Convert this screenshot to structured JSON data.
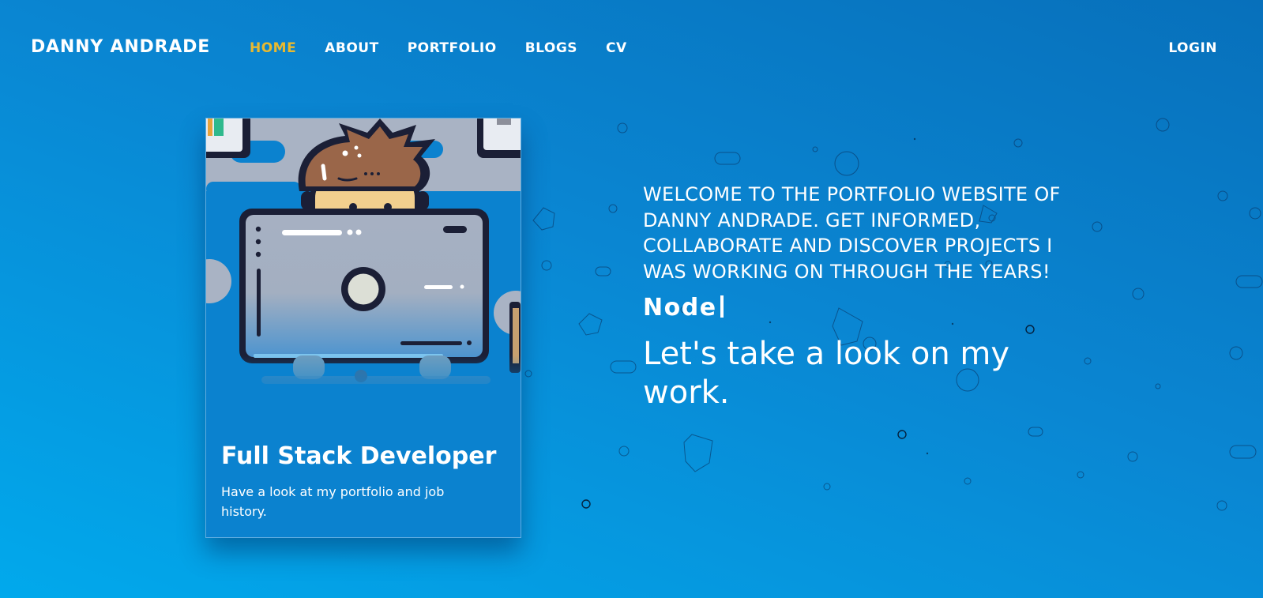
{
  "nav": {
    "brand": "DANNY ANDRADE",
    "links": [
      {
        "label": "HOME",
        "active": true
      },
      {
        "label": "ABOUT",
        "active": false
      },
      {
        "label": "PORTFOLIO",
        "active": false
      },
      {
        "label": "BLOGS",
        "active": false
      },
      {
        "label": "CV",
        "active": false
      }
    ],
    "login": "LOGIN"
  },
  "card": {
    "title": "Full Stack Developer",
    "text": "Have a look at my portfolio and job history."
  },
  "hero": {
    "welcome": "WELCOME TO THE PORTFOLIO WEBSITE OF DANNY ANDRADE. GET INFORMED, COLLABORATE AND DISCOVER PROJECTS I WAS WORKING ON THROUGH THE YEARS!",
    "typed_text": "Node",
    "tagline": "Let's take a look on my work."
  },
  "colors": {
    "accent": "#e8b930",
    "background_top": "#0770bb",
    "background_bottom": "#01a9ec"
  }
}
